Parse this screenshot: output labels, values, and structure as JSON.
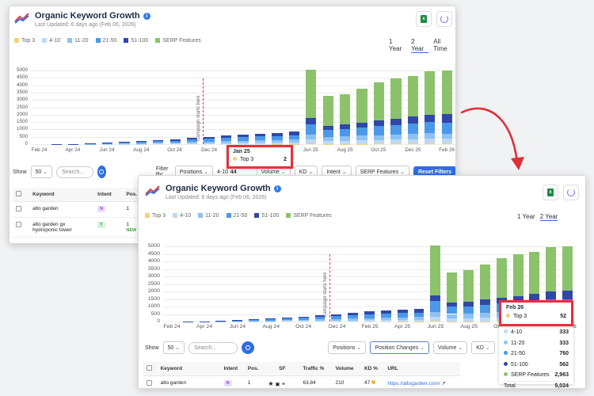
{
  "app": {
    "title": "Organic Keyword Growth",
    "info_icon": "i",
    "last_updated": "Last Updated: 6 days ago (Feb 06, 2026)",
    "excel_icon": "excel-icon",
    "loading_icon": "loading-icon"
  },
  "legend": [
    {
      "label": "Top 3",
      "color": "#f2d27a"
    },
    {
      "label": "4-10",
      "color": "#bcd9f7"
    },
    {
      "label": "11-20",
      "color": "#8ec2f2"
    },
    {
      "label": "21-50",
      "color": "#4b98e8"
    },
    {
      "label": "51-100",
      "color": "#3147a8"
    },
    {
      "label": "SERP Features",
      "color": "#8cc26b"
    }
  ],
  "range_options": {
    "one_year": "1 Year",
    "two_year": "2 Year",
    "all_time": "All Time"
  },
  "campaign_label": "Campaign starts here",
  "chart_data": {
    "type": "bar",
    "stacked": true,
    "categories": [
      "Feb 24",
      "Mar 24",
      "Apr 24",
      "May 24",
      "Jun 24",
      "Jul 24",
      "Aug 24",
      "Sep 24",
      "Oct 24",
      "Nov 24",
      "Dec 24",
      "Jan 25",
      "Feb 25",
      "Mar 25",
      "Apr 25",
      "May 25",
      "Jun 25",
      "Jul 25",
      "Aug 25",
      "Sep 25",
      "Oct 25",
      "Nov 25",
      "Dec 25",
      "Jan 26",
      "Feb 26"
    ],
    "x_tick_labels": [
      "Feb 24",
      "Apr 24",
      "Jun 24",
      "Aug 24",
      "Oct 24",
      "Dec 24",
      "Feb 25",
      "Apr 25",
      "Jun 25",
      "Aug 25",
      "Oct 25",
      "Dec 25",
      "Feb 26"
    ],
    "y_ticks": [
      0,
      500,
      1000,
      1500,
      2000,
      2500,
      3000,
      3500,
      4000,
      4500,
      5000
    ],
    "ylim": [
      0,
      5000
    ],
    "series": [
      {
        "name": "Top 3",
        "values": [
          0,
          0,
          0,
          0,
          0,
          0,
          0,
          0,
          0,
          0,
          0,
          2,
          3,
          4,
          5,
          8,
          30,
          20,
          22,
          25,
          30,
          35,
          40,
          45,
          52
        ]
      },
      {
        "name": "4-10",
        "values": [
          0,
          0,
          0,
          0,
          10,
          15,
          20,
          30,
          40,
          50,
          60,
          70,
          80,
          90,
          100,
          110,
          280,
          200,
          210,
          230,
          250,
          270,
          300,
          320,
          333
        ]
      },
      {
        "name": "11-20",
        "values": [
          0,
          0,
          5,
          10,
          20,
          30,
          40,
          60,
          70,
          90,
          110,
          130,
          150,
          160,
          170,
          180,
          340,
          280,
          290,
          310,
          330,
          350,
          380,
          400,
          333
        ]
      },
      {
        "name": "21-50",
        "values": [
          0,
          5,
          10,
          20,
          40,
          60,
          80,
          100,
          130,
          160,
          190,
          220,
          250,
          270,
          280,
          300,
          700,
          480,
          500,
          560,
          600,
          630,
          680,
          720,
          760
        ]
      },
      {
        "name": "51-100",
        "values": [
          0,
          5,
          10,
          15,
          30,
          40,
          60,
          80,
          100,
          120,
          140,
          160,
          180,
          200,
          220,
          240,
          400,
          280,
          300,
          350,
          380,
          420,
          460,
          500,
          562
        ]
      },
      {
        "name": "SERP Features",
        "values": [
          0,
          0,
          0,
          0,
          0,
          0,
          0,
          0,
          0,
          0,
          0,
          0,
          0,
          0,
          0,
          0,
          3300,
          2000,
          2080,
          2310,
          2610,
          2760,
          2790,
          2985,
          2963
        ]
      }
    ]
  },
  "tooltip_small": {
    "date": "Jan 25",
    "label": "Top 3",
    "value": "2"
  },
  "tooltip_big": {
    "date": "Feb 26",
    "rows": [
      {
        "label": "Top 3",
        "value": "52",
        "color": "#f2d27a"
      },
      {
        "label": "4-10",
        "value": "333",
        "color": "#bcd9f7"
      },
      {
        "label": "11-20",
        "value": "333",
        "color": "#8ec2f2"
      },
      {
        "label": "21-50",
        "value": "760",
        "color": "#4b98e8"
      },
      {
        "label": "51-100",
        "value": "562",
        "color": "#3147a8"
      },
      {
        "label": "SERP Features",
        "value": "2,963",
        "color": "#8cc26b"
      }
    ],
    "total_label": "Total",
    "total_value": "5,024"
  },
  "filters": {
    "show_label": "Show",
    "show_value": "50",
    "search_placeholder": "Search...",
    "filter_by": "Filter By:",
    "positions": "Positions",
    "position_changes": "Position Changes",
    "volume": "Volume",
    "kd": "KD",
    "intent": "Intent",
    "serp_features": "SERP Features",
    "reset": "Reset Filters",
    "peek_range": "4-10",
    "peek_value": "44"
  },
  "table": {
    "headers": [
      "Keyword",
      "Intent",
      "Pos.",
      "SF",
      "Traffic %",
      "Volume",
      "KD %",
      "URL"
    ],
    "rows": [
      {
        "keyword": "alto garden",
        "intent": "N",
        "pos": "1",
        "traffic": "63.84",
        "volume": "210",
        "kd": "47",
        "url": "https://altogarden.com/"
      },
      {
        "keyword": "alto garden gx hydroponic tower",
        "intent": "T",
        "pos": "1",
        "badge": "NEW"
      }
    ]
  }
}
